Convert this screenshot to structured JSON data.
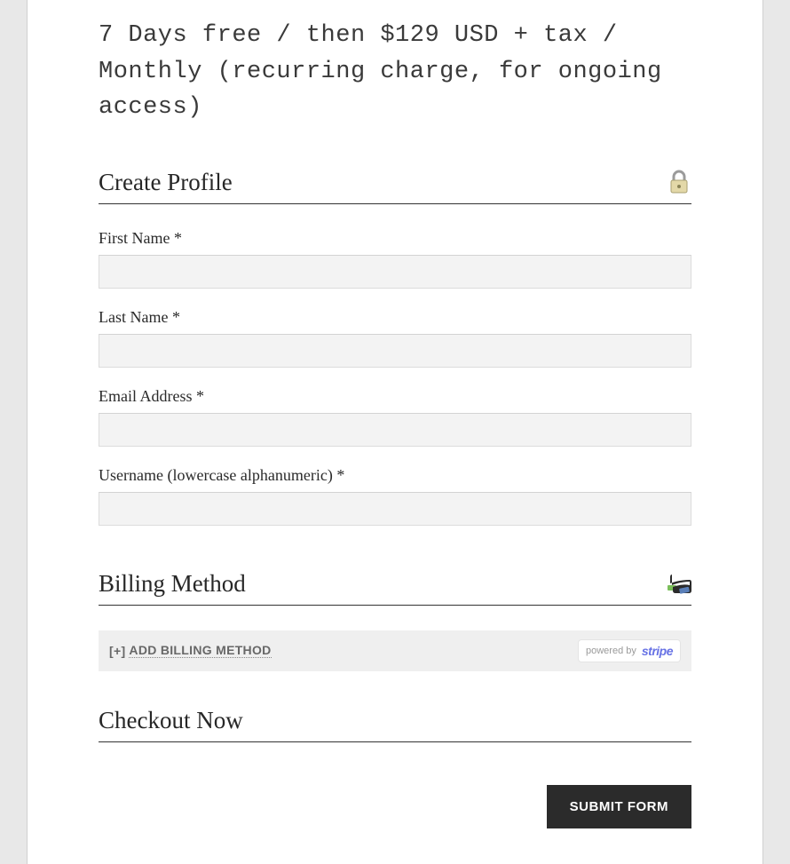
{
  "pricing_text": "7 Days free / then $129 USD + tax / Monthly (recurring charge, for ongoing access)",
  "sections": {
    "profile": {
      "heading": "Create Profile",
      "icon": "lock-icon",
      "fields": {
        "first_name": {
          "label": "First Name *",
          "value": ""
        },
        "last_name": {
          "label": "Last Name *",
          "value": ""
        },
        "email": {
          "label": "Email Address *",
          "value": ""
        },
        "username": {
          "label": "Username (lowercase alphanumeric) *",
          "value": ""
        }
      }
    },
    "billing": {
      "heading": "Billing Method",
      "icon": "wallet-icon",
      "add_prefix": "[+]",
      "add_label": "ADD BILLING METHOD",
      "powered_by": "powered by",
      "stripe": "stripe"
    },
    "checkout": {
      "heading": "Checkout Now",
      "submit_label": "SUBMIT FORM"
    }
  }
}
